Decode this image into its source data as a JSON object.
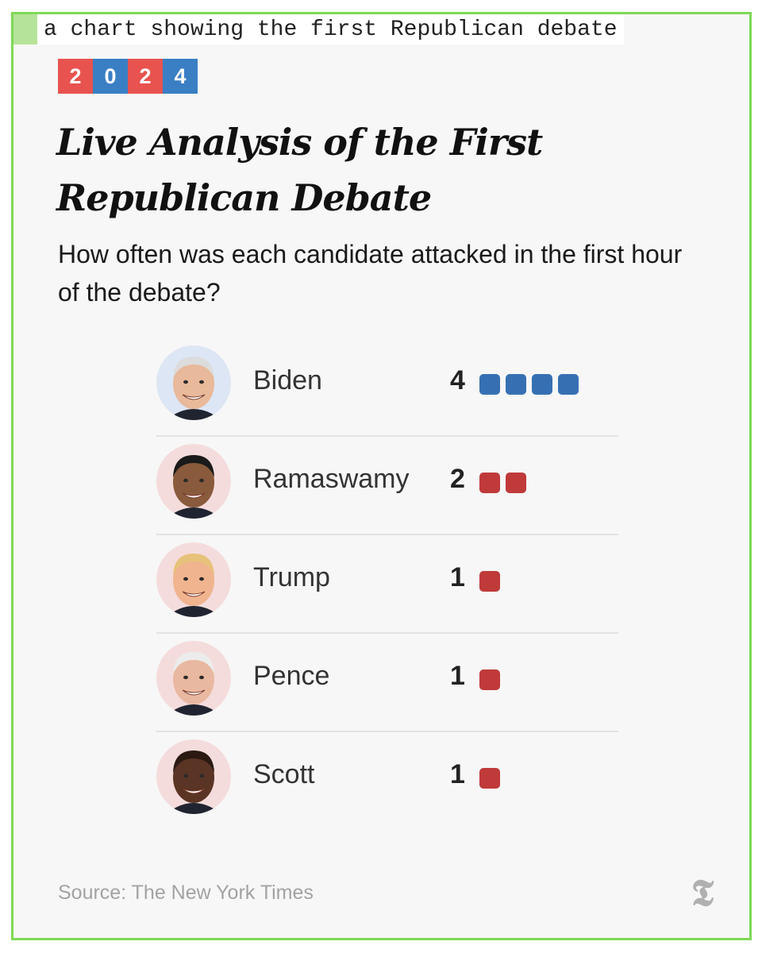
{
  "caption": "a chart showing the first Republican debate",
  "badge": {
    "digits": [
      "2",
      "0",
      "2",
      "4"
    ],
    "colors": [
      "#e8534f",
      "#3a7fc4",
      "#e8534f",
      "#3a7fc4"
    ]
  },
  "title": "Live Analysis of the First Republican Debate",
  "subtitle": "How often was each candidate attacked in the first hour of the debate?",
  "colors": {
    "democrat": "#3670b3",
    "republican": "#c03a3a",
    "frame": "#7ed957"
  },
  "chart_data": {
    "type": "bar",
    "categories": [
      "Biden",
      "Ramaswamy",
      "Trump",
      "Pence",
      "Scott"
    ],
    "values": [
      4,
      2,
      1,
      1,
      1
    ],
    "party": [
      "democrat",
      "republican",
      "republican",
      "republican",
      "republican"
    ],
    "title": "How often was each candidate attacked in the first hour of the debate?",
    "xlabel": "",
    "ylabel": ""
  },
  "source": "Source: The New York Times",
  "logo_icon": "nyt-logo-icon"
}
